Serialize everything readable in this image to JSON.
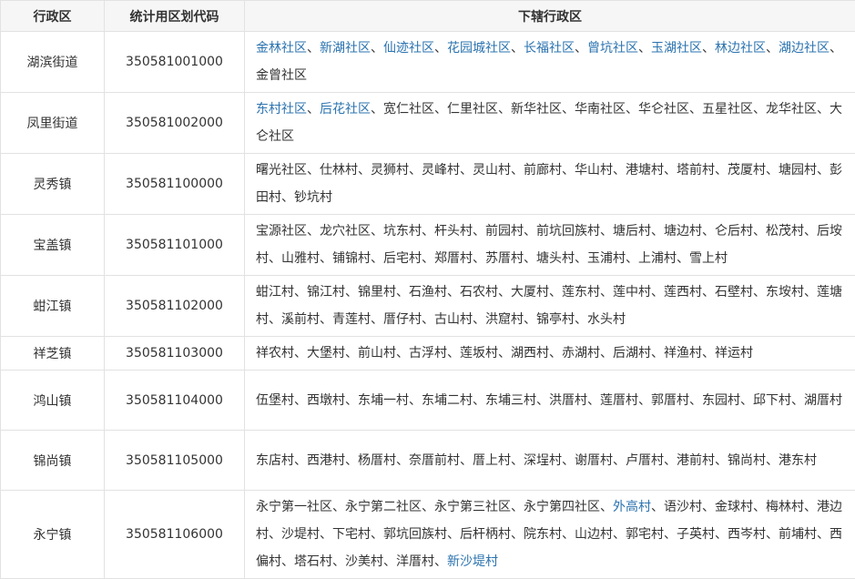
{
  "table": {
    "headers": [
      "行政区",
      "统计用区划代码",
      "下辖行政区"
    ],
    "rows": [
      {
        "district": "湖滨街道",
        "code": "350581001000",
        "subunits": [
          {
            "name": "金林社区",
            "link": true
          },
          {
            "name": "新湖社区",
            "link": true
          },
          {
            "name": "仙迹社区",
            "link": true
          },
          {
            "name": "花园城社区",
            "link": true
          },
          {
            "name": "长福社区",
            "link": true
          },
          {
            "name": "曾坑社区",
            "link": true
          },
          {
            "name": "玉湖社区",
            "link": true
          },
          {
            "name": "林边社区",
            "link": true
          },
          {
            "name": "湖边社区",
            "link": true
          },
          {
            "name": "金曾社区",
            "link": false
          }
        ]
      },
      {
        "district": "凤里街道",
        "code": "350581002000",
        "subunits": [
          {
            "name": "东村社区",
            "link": true
          },
          {
            "name": "后花社区",
            "link": true
          },
          {
            "name": "宽仁社区",
            "link": false
          },
          {
            "name": "仁里社区",
            "link": false
          },
          {
            "name": "新华社区",
            "link": false
          },
          {
            "name": "华南社区",
            "link": false
          },
          {
            "name": "华仑社区",
            "link": false
          },
          {
            "name": "五星社区",
            "link": false
          },
          {
            "name": "龙华社区",
            "link": false
          },
          {
            "name": "大仑社区",
            "link": false
          }
        ]
      },
      {
        "district": "灵秀镇",
        "code": "350581100000",
        "subunits": [
          {
            "name": "曙光社区",
            "link": false
          },
          {
            "name": "仕林村",
            "link": false
          },
          {
            "name": "灵狮村",
            "link": false
          },
          {
            "name": "灵峰村",
            "link": false
          },
          {
            "name": "灵山村",
            "link": false
          },
          {
            "name": "前廊村",
            "link": false
          },
          {
            "name": "华山村",
            "link": false
          },
          {
            "name": "港塘村",
            "link": false
          },
          {
            "name": "塔前村",
            "link": false
          },
          {
            "name": "茂厦村",
            "link": false
          },
          {
            "name": "塘园村",
            "link": false
          },
          {
            "name": "彭田村",
            "link": false
          },
          {
            "name": "钞坑村",
            "link": false
          }
        ]
      },
      {
        "district": "宝盖镇",
        "code": "350581101000",
        "subunits": [
          {
            "name": "宝源社区",
            "link": false
          },
          {
            "name": "龙穴社区",
            "link": false
          },
          {
            "name": "坑东村",
            "link": false
          },
          {
            "name": "杆头村",
            "link": false
          },
          {
            "name": "前园村",
            "link": false
          },
          {
            "name": "前坑回族村",
            "link": false
          },
          {
            "name": "塘后村",
            "link": false
          },
          {
            "name": "塘边村",
            "link": false
          },
          {
            "name": "仑后村",
            "link": false
          },
          {
            "name": "松茂村",
            "link": false
          },
          {
            "name": "后垵村",
            "link": false
          },
          {
            "name": "山雅村",
            "link": false
          },
          {
            "name": "铺锦村",
            "link": false
          },
          {
            "name": "后宅村",
            "link": false
          },
          {
            "name": "郑厝村",
            "link": false
          },
          {
            "name": "苏厝村",
            "link": false
          },
          {
            "name": "塘头村",
            "link": false
          },
          {
            "name": "玉浦村",
            "link": false
          },
          {
            "name": "上浦村",
            "link": false
          },
          {
            "name": "雪上村",
            "link": false
          }
        ]
      },
      {
        "district": "蚶江镇",
        "code": "350581102000",
        "subunits": [
          {
            "name": "蚶江村",
            "link": false
          },
          {
            "name": "锦江村",
            "link": false
          },
          {
            "name": "锦里村",
            "link": false
          },
          {
            "name": "石渔村",
            "link": false
          },
          {
            "name": "石农村",
            "link": false
          },
          {
            "name": "大厦村",
            "link": false
          },
          {
            "name": "莲东村",
            "link": false
          },
          {
            "name": "莲中村",
            "link": false
          },
          {
            "name": "莲西村",
            "link": false
          },
          {
            "name": "石壁村",
            "link": false
          },
          {
            "name": "东垵村",
            "link": false
          },
          {
            "name": "莲塘村",
            "link": false
          },
          {
            "name": "溪前村",
            "link": false
          },
          {
            "name": "青莲村",
            "link": false
          },
          {
            "name": "厝仔村",
            "link": false
          },
          {
            "name": "古山村",
            "link": false
          },
          {
            "name": "洪窟村",
            "link": false
          },
          {
            "name": "锦亭村",
            "link": false
          },
          {
            "name": "水头村",
            "link": false
          }
        ]
      },
      {
        "district": "祥芝镇",
        "code": "350581103000",
        "subunits": [
          {
            "name": "祥农村",
            "link": false
          },
          {
            "name": "大堡村",
            "link": false
          },
          {
            "name": "前山村",
            "link": false
          },
          {
            "name": "古浮村",
            "link": false
          },
          {
            "name": "莲坂村",
            "link": false
          },
          {
            "name": "湖西村",
            "link": false
          },
          {
            "name": "赤湖村",
            "link": false
          },
          {
            "name": "后湖村",
            "link": false
          },
          {
            "name": "祥渔村",
            "link": false
          },
          {
            "name": "祥运村",
            "link": false
          }
        ]
      },
      {
        "district": "鸿山镇",
        "code": "350581104000",
        "subunits": [
          {
            "name": "伍堡村",
            "link": false
          },
          {
            "name": "西墩村",
            "link": false
          },
          {
            "name": "东埔一村",
            "link": false
          },
          {
            "name": "东埔二村",
            "link": false
          },
          {
            "name": "东埔三村",
            "link": false
          },
          {
            "name": "洪厝村",
            "link": false
          },
          {
            "name": "莲厝村",
            "link": false
          },
          {
            "name": "郭厝村",
            "link": false
          },
          {
            "name": "东园村",
            "link": false
          },
          {
            "name": "邱下村",
            "link": false
          },
          {
            "name": "湖厝村",
            "link": false
          }
        ]
      },
      {
        "district": "锦尚镇",
        "code": "350581105000",
        "subunits": [
          {
            "name": "东店村",
            "link": false
          },
          {
            "name": "西港村",
            "link": false
          },
          {
            "name": "杨厝村",
            "link": false
          },
          {
            "name": "奈厝前村",
            "link": false
          },
          {
            "name": "厝上村",
            "link": false
          },
          {
            "name": "深埕村",
            "link": false
          },
          {
            "name": "谢厝村",
            "link": false
          },
          {
            "name": "卢厝村",
            "link": false
          },
          {
            "name": "港前村",
            "link": false
          },
          {
            "name": "锦尚村",
            "link": false
          },
          {
            "name": "港东村",
            "link": false
          }
        ]
      },
      {
        "district": "永宁镇",
        "code": "350581106000",
        "subunits": [
          {
            "name": "永宁第一社区",
            "link": false
          },
          {
            "name": "永宁第二社区",
            "link": false
          },
          {
            "name": "永宁第三社区",
            "link": false
          },
          {
            "name": "永宁第四社区",
            "link": false
          },
          {
            "name": "外高村",
            "link": true
          },
          {
            "name": "语沙村",
            "link": false
          },
          {
            "name": "金球村",
            "link": false
          },
          {
            "name": "梅林村",
            "link": false
          },
          {
            "name": "港边村",
            "link": false
          },
          {
            "name": "沙堤村",
            "link": false
          },
          {
            "name": "下宅村",
            "link": false
          },
          {
            "name": "郭坑回族村",
            "link": false
          },
          {
            "name": "后杆柄村",
            "link": false
          },
          {
            "name": "院东村",
            "link": false
          },
          {
            "name": "山边村",
            "link": false
          },
          {
            "name": "郭宅村",
            "link": false
          },
          {
            "name": "子英村",
            "link": false
          },
          {
            "name": "西岑村",
            "link": false
          },
          {
            "name": "前埔村",
            "link": false
          },
          {
            "name": "西偏村",
            "link": false
          },
          {
            "name": "塔石村",
            "link": false
          },
          {
            "name": "沙美村",
            "link": false
          },
          {
            "name": "洋厝村",
            "link": false
          },
          {
            "name": "新沙堤村",
            "link": true
          }
        ]
      }
    ]
  },
  "colors": {
    "link": "#2b73af",
    "text": "#333333",
    "header_bg": "#f6f6f6",
    "border": "#e2e2e2"
  }
}
